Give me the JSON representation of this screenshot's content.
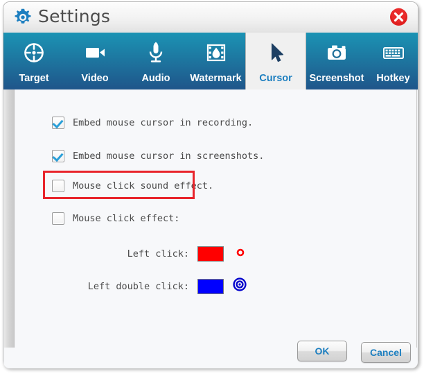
{
  "window": {
    "title": "Settings",
    "gear_icon": "gear-icon",
    "close_icon": "close-icon",
    "close_label": "Close"
  },
  "tabs": [
    {
      "label": "Target",
      "icon": "target-crosshair-icon",
      "active": false
    },
    {
      "label": "Video",
      "icon": "video-camera-icon",
      "active": false
    },
    {
      "label": "Audio",
      "icon": "microphone-icon",
      "active": false
    },
    {
      "label": "Watermark",
      "icon": "filmstrip-droplet-icon",
      "active": false
    },
    {
      "label": "Cursor",
      "icon": "mouse-pointer-icon",
      "active": true
    },
    {
      "label": "Screenshot",
      "icon": "camera-icon",
      "active": false
    },
    {
      "label": "Hotkey",
      "icon": "keyboard-icon",
      "active": false
    }
  ],
  "cursor_panel": {
    "options": [
      {
        "label": "Embed mouse cursor in recording.",
        "checked": true
      },
      {
        "label": "Embed mouse cursor in screenshots.",
        "checked": true
      },
      {
        "label": "Mouse click sound effect.",
        "checked": false
      },
      {
        "label": "Mouse click effect:",
        "checked": false
      }
    ],
    "highlighted_option_index": 2,
    "highlight_color": "#e8242b",
    "click_colors": [
      {
        "label": "Left click:",
        "color": "#ff0000",
        "preview": "small-ring-icon"
      },
      {
        "label": "Left double click:",
        "color": "#0000ff",
        "preview": "bullseye-icon"
      }
    ]
  },
  "footer": {
    "ok_label": "OK",
    "cancel_label": "Cancel"
  },
  "theme": {
    "tab_top": "#1b93b4",
    "tab_bottom": "#1f558a",
    "accent_blue": "#1d7fc0",
    "panel_bg": "#f7f8fa"
  }
}
